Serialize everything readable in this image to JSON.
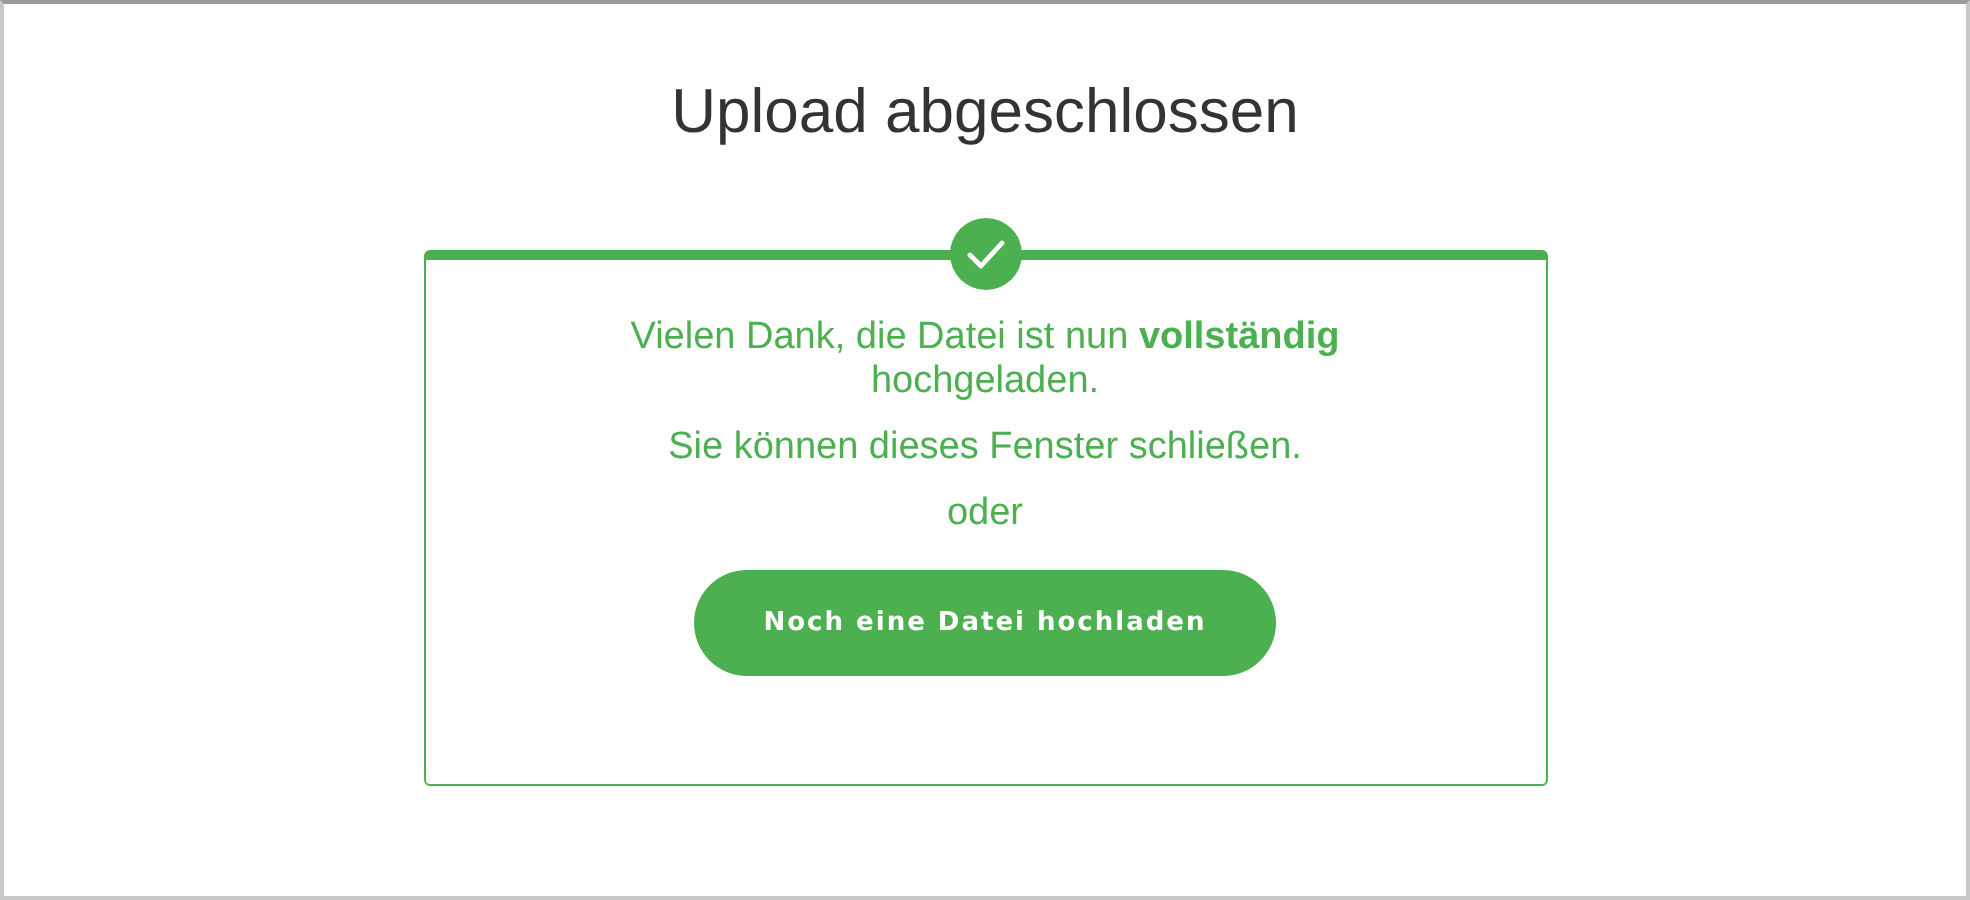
{
  "title": "Upload abgeschlossen",
  "card": {
    "message": "Vielen Dank, die Datei ist nun  **vollständig** hochgeladen.",
    "hint": "Sie können dieses Fenster schließen.",
    "separator": "oder",
    "button": "Noch eine Datei hochladen"
  }
}
